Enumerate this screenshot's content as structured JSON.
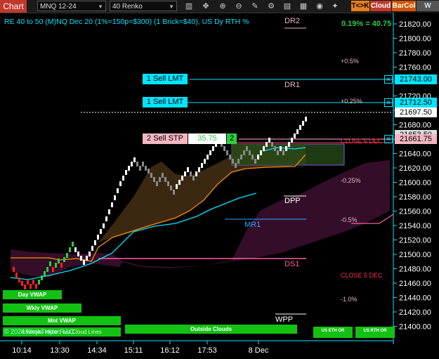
{
  "toolbar": {
    "title": "Chart",
    "instrument": "MNQ 12-24",
    "bar_type": "40 Renko",
    "buttons": [
      {
        "label": "T<>K",
        "color": "#e67e22"
      },
      {
        "label": "Cloud",
        "color": "#c0392b"
      },
      {
        "label": "BarCol",
        "color": "#d35400"
      },
      {
        "label": "W VWAP",
        "color": "#555555"
      }
    ],
    "icons": [
      "bars-icon",
      "crosshair-icon",
      "zoom-in-icon",
      "zoom-out-icon",
      "draw-icon",
      "properties-icon",
      "template-icon",
      "data-box-icon",
      "global-icon"
    ]
  },
  "header": {
    "description": "RE 40 to 50 (M)NQ Dec 20 (1%=150p=$300) (1 Brick=$40), US Dy RTH %",
    "change": "0.19% = 40.75"
  },
  "colors": {
    "accent_cyan": "#00e5ff",
    "order_sell_lmt": "#00e5ff",
    "order_sell_stp": "#f4b6c2",
    "positive_green": "#2ecc40",
    "negative_red": "#ff2020",
    "ichimoku_orange": "#ff8c00",
    "cloud_purple": "#3a0f2e",
    "cloud_brown": "#3d2a12",
    "level_pink": "#ff5ca8",
    "dr_label": "#e8b4c8",
    "mr_label": "#3aa0ff"
  },
  "price_axis": {
    "ticks": [
      "21820.00",
      "21800.00",
      "21780.00",
      "21760.00",
      "21740.00",
      "21720.00",
      "21700.00",
      "21680.00",
      "21660.00",
      "21640.00",
      "21620.00",
      "21600.00",
      "21580.00",
      "21560.00",
      "21540.00",
      "21520.00",
      "21500.00",
      "21480.00",
      "21460.00",
      "21440.00",
      "21420.00",
      "21400.00"
    ],
    "tags": [
      {
        "label": "21743.00",
        "style": "cyan"
      },
      {
        "label": "21712.50",
        "style": "cyan"
      },
      {
        "label": "21697.50",
        "style": "white"
      },
      {
        "label": "21661.75",
        "style": "pink"
      },
      {
        "label": "21653.50",
        "style": "hidden"
      }
    ]
  },
  "time_axis": {
    "ticks": [
      "10:14",
      "13:30",
      "14:34",
      "15:11",
      "16:12",
      "17:53",
      "8 Dec"
    ]
  },
  "orders": [
    {
      "label": "1 Sell LMT",
      "price": "21743.00"
    },
    {
      "label": "1 Sell LMT",
      "price": "21712.50"
    },
    {
      "label": "2 Sell STP",
      "price": "21661.75",
      "value": "35.75",
      "qty": "2"
    }
  ],
  "levels": {
    "dr2": "DR2",
    "dr1": "DR1",
    "dpp": "DPP",
    "mr1": "MR1",
    "ds1": "DS1",
    "wpp": "WPP",
    "pct_plus_05": "+0.5%",
    "pct_plus_025": "+0.25%",
    "pct_minus_025": "-0.25%",
    "pct_minus_05": "-0.5%",
    "pct_minus_1": "-1.0%",
    "close6": "CLOSE 6 DEC",
    "close5": "CLOSE 5 DEC"
  },
  "legend_bars": {
    "day_vwap": "Day VWAP",
    "wkly_vwap": "Wkly VWAP",
    "mnt_vwap": "Mnt VWAP",
    "outside_clouds": "Outside Clouds",
    "us_eth_or": "US ETH OR",
    "us_rth_or": "US RTH OR",
    "copyright": "© 2024 NinjaTrader, LLC",
    "cloud_lines": "Ichimoku Hijue Fast Cloud Lines"
  }
}
